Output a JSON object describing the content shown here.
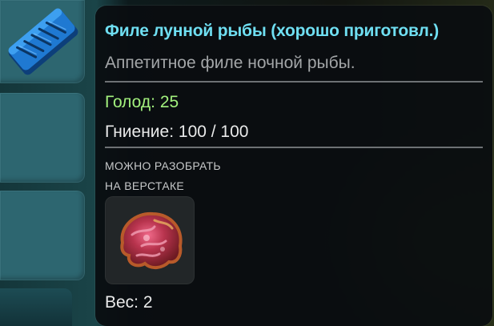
{
  "inventory": {
    "slots": [
      {
        "icon": "moonfish-fillet-icon",
        "filled": true
      },
      {
        "icon": "",
        "filled": false
      },
      {
        "icon": "",
        "filled": false
      }
    ]
  },
  "tooltip": {
    "title": "Филе лунной рыбы (хорошо приготовл.)",
    "description": "Аппетитное филе ночной рыбы.",
    "hunger_label": "Голод:",
    "hunger_value": "25",
    "rot_label": "Гниение:",
    "rot_value": "100 / 100",
    "salvage_line1": "МОЖНО РАЗОБРАТЬ",
    "salvage_line2": "НА ВЕРСТАКЕ",
    "salvage_result_icon": "raw-meat-icon",
    "weight_label": "Вес:",
    "weight_value": "2"
  },
  "colors": {
    "title": "#6fdff2",
    "hunger": "#a2f07d",
    "description": "#a3a6a8",
    "text": "#e9eaea",
    "slot": "#2d6670",
    "panel": "#0a0d10"
  }
}
